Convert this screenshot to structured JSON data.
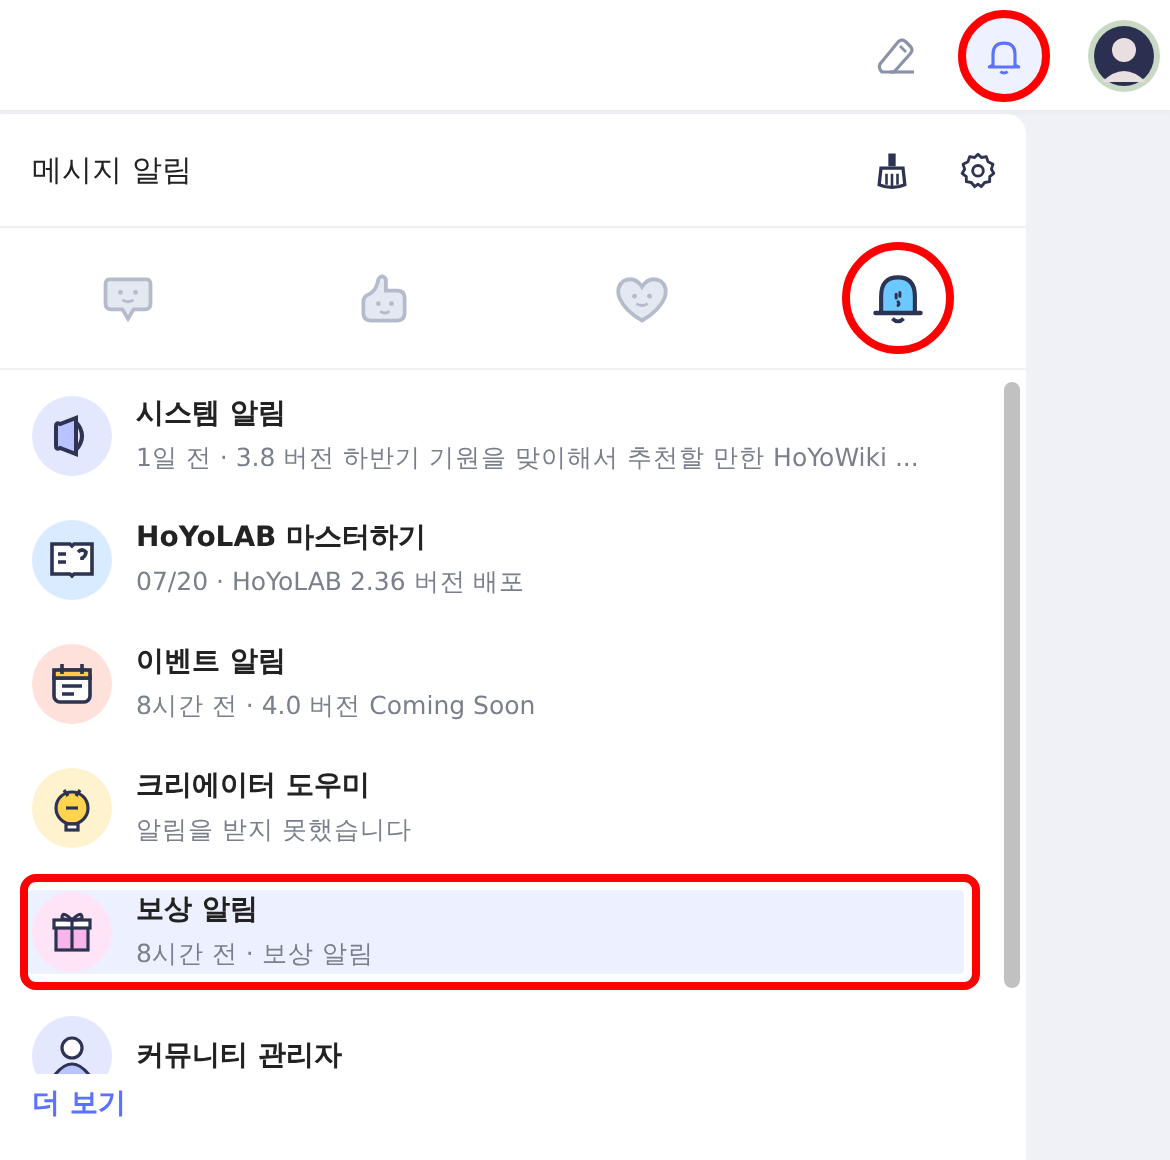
{
  "top_bar": {
    "notifications_annotated": true
  },
  "panel": {
    "title": "메시지 알림",
    "tabs": [
      {
        "kind": "comment",
        "selected": false,
        "annotated": false
      },
      {
        "kind": "like",
        "selected": false,
        "annotated": false
      },
      {
        "kind": "heart",
        "selected": false,
        "annotated": false
      },
      {
        "kind": "bell",
        "selected": true,
        "annotated": true
      }
    ],
    "items": [
      {
        "kind": "system",
        "color": "#e3e8ff",
        "title": "시스템 알림",
        "subtitle": "1일 전 · 3.8 버전 하반기 기원을 맞이해서 추천할 만한 HoYoWiki ...",
        "selected": false,
        "annotated": false
      },
      {
        "kind": "guide",
        "color": "#d9ebff",
        "title": "HoYoLAB 마스터하기",
        "subtitle": "07/20 · HoYoLAB 2.36 버전 배포",
        "selected": false,
        "annotated": false
      },
      {
        "kind": "event",
        "color": "#ffe1dc",
        "title": "이벤트 알림",
        "subtitle": "8시간 전 · 4.0 버전 Coming Soon",
        "selected": false,
        "annotated": false
      },
      {
        "kind": "creator",
        "color": "#fff3cf",
        "title": "크리에이터 도우미",
        "subtitle": "알림을 받지 못했습니다",
        "selected": false,
        "annotated": false
      },
      {
        "kind": "reward",
        "color": "#ffe3f6",
        "title": "보상 알림",
        "subtitle": "8시간 전 · 보상 알림",
        "selected": true,
        "annotated": true
      },
      {
        "kind": "community",
        "color": "#e3e8ff",
        "title": "커뮤니티 관리자",
        "selected": false,
        "annotated": false
      }
    ],
    "more_link": "더 보기"
  }
}
